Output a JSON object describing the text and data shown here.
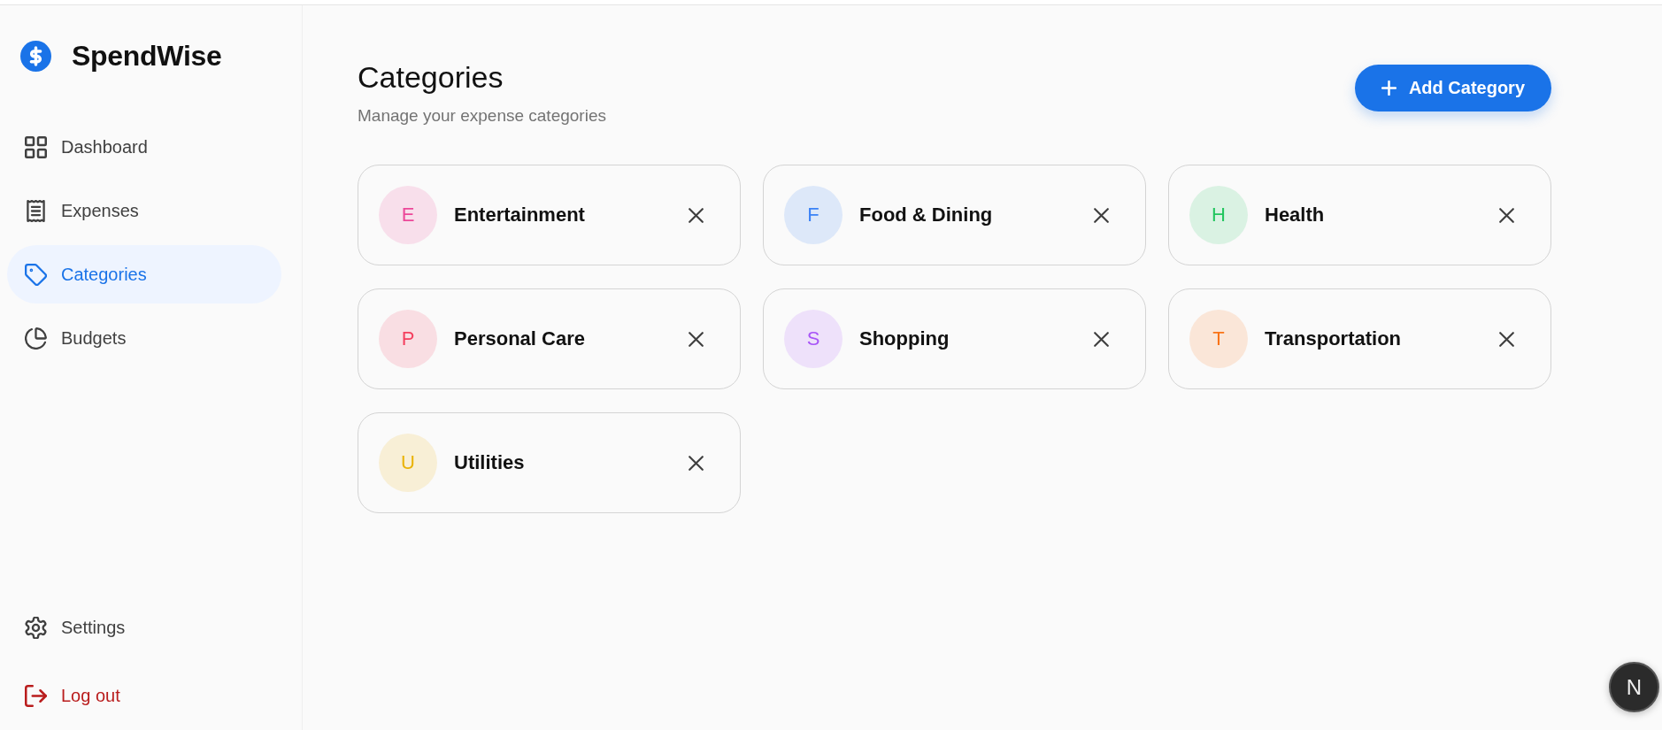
{
  "sidebar": {
    "brand": "SpendWise",
    "nav_items": [
      {
        "label": "Dashboard",
        "selected": false
      },
      {
        "label": "Expenses",
        "selected": false
      },
      {
        "label": "Categories",
        "selected": true
      },
      {
        "label": "Budgets",
        "selected": false
      }
    ],
    "footer_items": [
      {
        "label": "Settings",
        "kind": "link"
      },
      {
        "label": "Log out",
        "kind": "danger"
      }
    ]
  },
  "header": {
    "title": "Categories",
    "subtitle": "Manage your expense categories",
    "add_button": {
      "label": "Add Category"
    }
  },
  "categories": [
    {
      "initial": "E",
      "name": "Entertainment",
      "color": "#ec4899"
    },
    {
      "initial": "F",
      "name": "Food & Dining",
      "color": "#3b82f6"
    },
    {
      "initial": "H",
      "name": "Health",
      "color": "#22c55e"
    },
    {
      "initial": "P",
      "name": "Personal Care",
      "color": "#f43f5e"
    },
    {
      "initial": "S",
      "name": "Shopping",
      "color": "#a855f7"
    },
    {
      "initial": "T",
      "name": "Transportation",
      "color": "#f97316"
    },
    {
      "initial": "U",
      "name": "Utilities",
      "color": "#eab308"
    }
  ],
  "dev_badge": {
    "label": "N"
  }
}
